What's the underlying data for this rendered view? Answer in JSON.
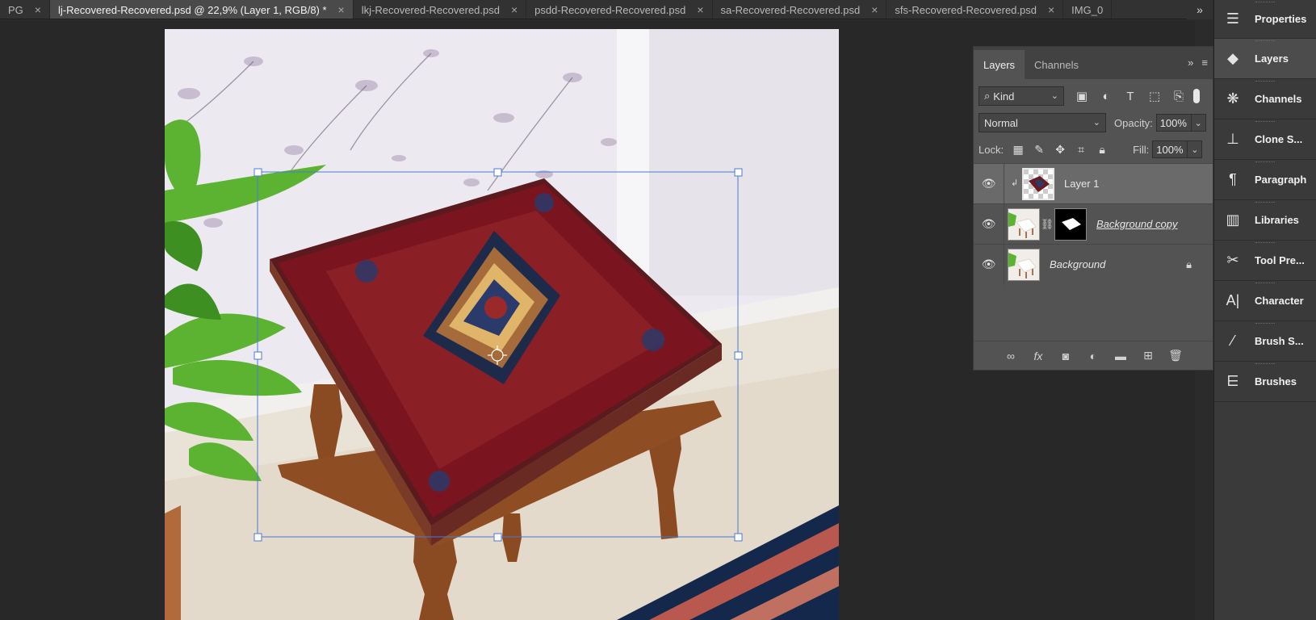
{
  "tabs": [
    {
      "label": "PG",
      "active": false
    },
    {
      "label": "lj-Recovered-Recovered.psd @ 22,9% (Layer 1, RGB/8) *",
      "active": true
    },
    {
      "label": "lkj-Recovered-Recovered.psd",
      "active": false
    },
    {
      "label": "psdd-Recovered-Recovered.psd",
      "active": false
    },
    {
      "label": "sa-Recovered-Recovered.psd",
      "active": false
    },
    {
      "label": "sfs-Recovered-Recovered.psd",
      "active": false
    },
    {
      "label": "IMG_0",
      "active": false
    }
  ],
  "tab_close_glyph": "×",
  "tab_overflow": "»",
  "layers_panel": {
    "tab_layers": "Layers",
    "tab_channels": "Channels",
    "filter_kind": "Kind",
    "blend_mode": "Normal",
    "opacity_label": "Opacity:",
    "opacity_value": "100%",
    "lock_label": "Lock:",
    "fill_label": "Fill:",
    "fill_value": "100%",
    "layers": [
      {
        "name": "Layer 1",
        "selected": true,
        "visible": true
      },
      {
        "name": "Background copy",
        "selected": false,
        "visible": true,
        "has_mask": true
      },
      {
        "name": "Background",
        "selected": false,
        "visible": true,
        "locked": true
      }
    ]
  },
  "dock": {
    "items": [
      {
        "label": "Properties",
        "icon": "sliders-icon"
      },
      {
        "label": "Layers",
        "icon": "layers-icon",
        "active": true
      },
      {
        "label": "Channels",
        "icon": "channels-icon"
      },
      {
        "label": "Clone S...",
        "icon": "clone-stamp-icon"
      },
      {
        "label": "Paragraph",
        "icon": "paragraph-icon"
      },
      {
        "label": "Libraries",
        "icon": "libraries-icon"
      },
      {
        "label": "Tool Pre...",
        "icon": "tool-presets-icon"
      },
      {
        "label": "Character",
        "icon": "character-icon"
      },
      {
        "label": "Brush S...",
        "icon": "brush-settings-icon"
      },
      {
        "label": "Brushes",
        "icon": "brushes-icon"
      }
    ]
  },
  "colors": {
    "selection_box": "#4a7bd4",
    "carpet_red": "#7a1520",
    "wood": "#8a4a22",
    "plant_green": "#4ea62a"
  }
}
